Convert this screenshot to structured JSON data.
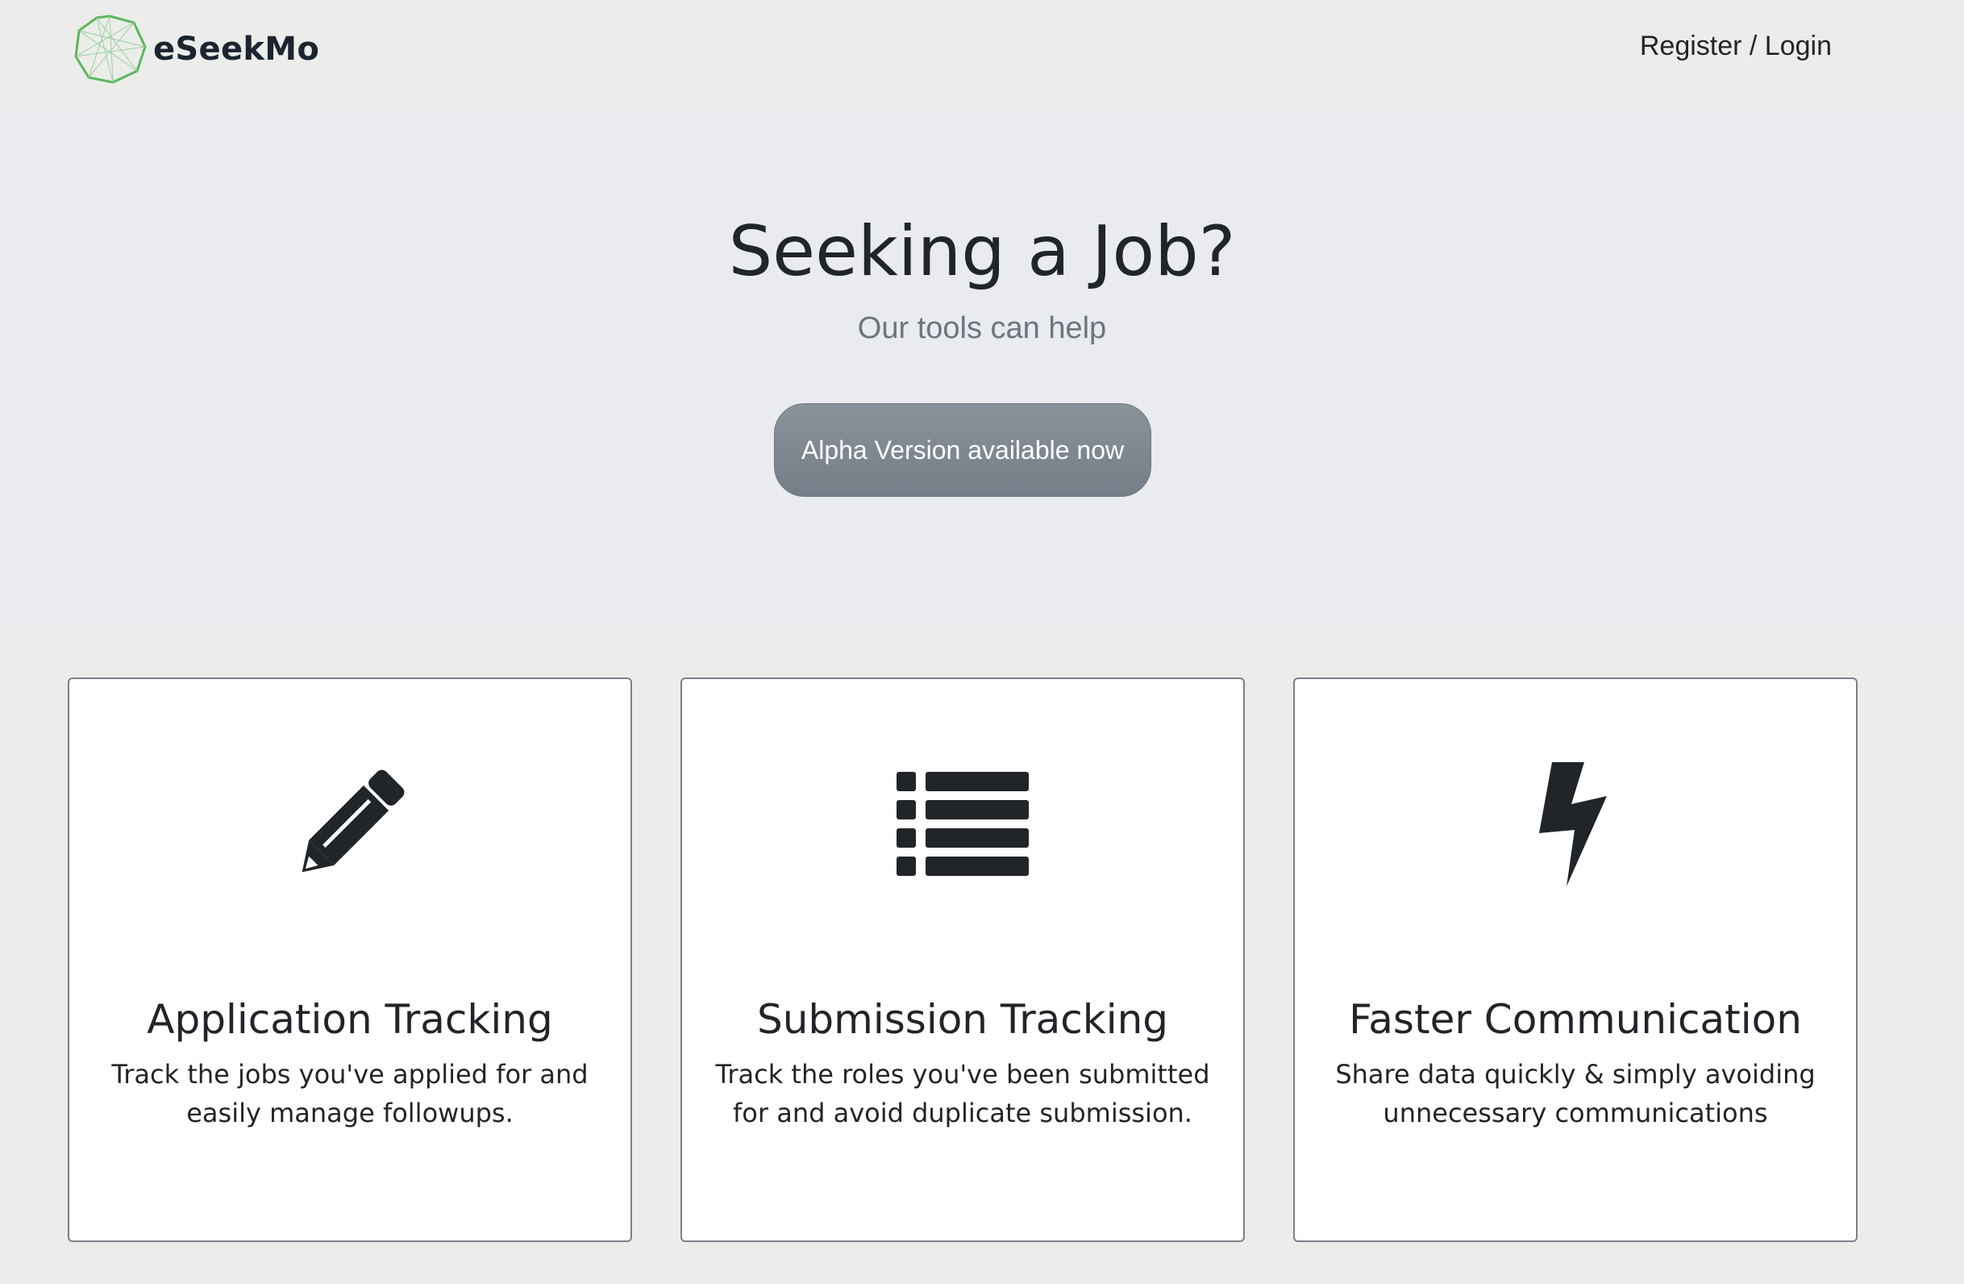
{
  "nav": {
    "brand_name": "eSeekMo",
    "auth_link": "Register / Login",
    "logo_color": "#5cb85c"
  },
  "hero": {
    "title": "Seeking a Job?",
    "subtitle": "Our tools can help",
    "cta_label": "Alpha Version available now"
  },
  "features": [
    {
      "icon": "pencil-icon",
      "title": "Application Tracking",
      "text": "Track the jobs you've applied for and easily manage followups."
    },
    {
      "icon": "list-icon",
      "title": "Submission Tracking",
      "text": "Track the roles you've been submitted for and avoid duplicate submission."
    },
    {
      "icon": "bolt-icon",
      "title": "Faster Communication",
      "text": "Share data quickly & simply avoiding unnecessary communications"
    }
  ],
  "colors": {
    "page_bg": "#ecedeb",
    "hero_bg": "#e9ebee",
    "button_bg": "#7d868f",
    "icon": "#212529"
  }
}
